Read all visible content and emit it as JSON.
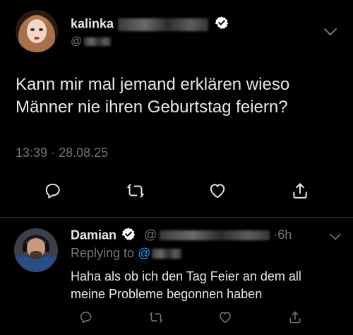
{
  "main_tweet": {
    "display_name": "kalinka",
    "handle_prefix": "@",
    "text_line1": "Kann mir mal jemand erklären wieso",
    "text_line2": "Männer nie ihren Geburtstag feiern?",
    "time": "13:39",
    "separator": "·",
    "date": "28.08.25"
  },
  "reply": {
    "display_name": "Damian",
    "handle_prefix": "@",
    "separator": "·",
    "age": "6h",
    "replying_to_label": "Replying to",
    "replying_to_handle": "@",
    "text_line1": "Haha als ob ich den Tag Feier an dem all",
    "text_line2": "meine Probleme begonnen haben"
  },
  "colors": {
    "background": "#000000",
    "text": "#e7e9ea",
    "secondary": "#71767b",
    "accent": "#1d9bf0",
    "divider": "#2f3336"
  },
  "icons": {
    "reply": "speech-bubble-icon",
    "retweet": "retweet-icon",
    "like": "heart-icon",
    "share": "share-icon",
    "verified": "verified-badge-icon",
    "more": "chevron-down-icon"
  }
}
